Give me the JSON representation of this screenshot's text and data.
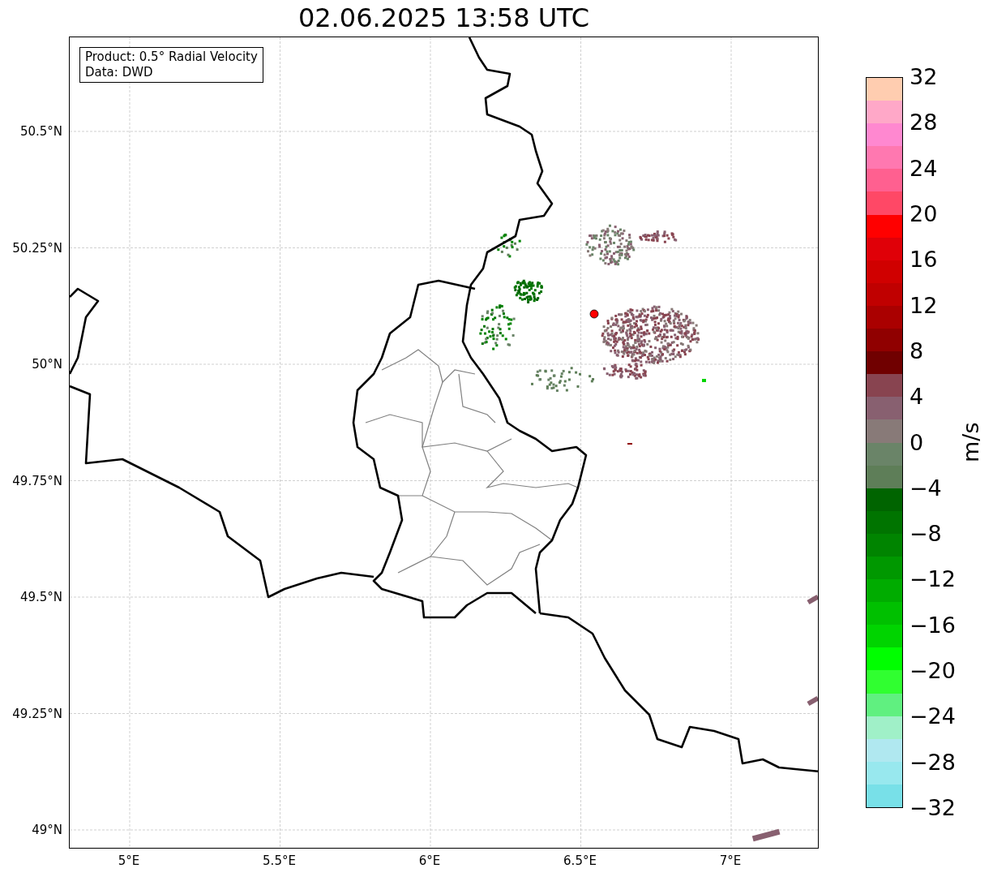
{
  "title": "02.06.2025 13:58 UTC",
  "info_box": [
    "Product: 0.5° Radial Velocity",
    "Data: DWD"
  ],
  "map": {
    "y_ticks": [
      "50.5°N",
      "50.25°N",
      "50°N",
      "49.75°N",
      "49.5°N",
      "49.25°N",
      "49°N"
    ],
    "x_ticks": [
      "5°E",
      "5.5°E",
      "6°E",
      "6.5°E",
      "7°E"
    ]
  },
  "colorbar": {
    "label": "m/s",
    "ticks": [
      "32",
      "28",
      "24",
      "20",
      "16",
      "12",
      "8",
      "4",
      "0",
      "−4",
      "−8",
      "−12",
      "−16",
      "−20",
      "−24",
      "−28",
      "−32"
    ],
    "bands": [
      {
        "color": "#ffcdb0"
      },
      {
        "color": "#ffa8c8"
      },
      {
        "color": "#ff88d0"
      },
      {
        "color": "#ff78b0"
      },
      {
        "color": "#ff6090"
      },
      {
        "color": "#ff4866"
      },
      {
        "color": "#ff0000"
      },
      {
        "color": "#e00008"
      },
      {
        "color": "#d00000"
      },
      {
        "color": "#c00000"
      },
      {
        "color": "#aa0000"
      },
      {
        "color": "#900000"
      },
      {
        "color": "#700000"
      },
      {
        "color": "#884450"
      },
      {
        "color": "#886070"
      },
      {
        "color": "#887a78"
      },
      {
        "color": "#6a8468"
      },
      {
        "color": "#5e7e58"
      },
      {
        "color": "#006400"
      },
      {
        "color": "#007400"
      },
      {
        "color": "#008400"
      },
      {
        "color": "#009800"
      },
      {
        "color": "#00ac00"
      },
      {
        "color": "#00c000"
      },
      {
        "color": "#00d400"
      },
      {
        "color": "#00ff00"
      },
      {
        "color": "#30ff30"
      },
      {
        "color": "#60f080"
      },
      {
        "color": "#a0f0c8"
      },
      {
        "color": "#b0e8f0"
      },
      {
        "color": "#98e8ee"
      },
      {
        "color": "#78e0e8"
      }
    ]
  }
}
